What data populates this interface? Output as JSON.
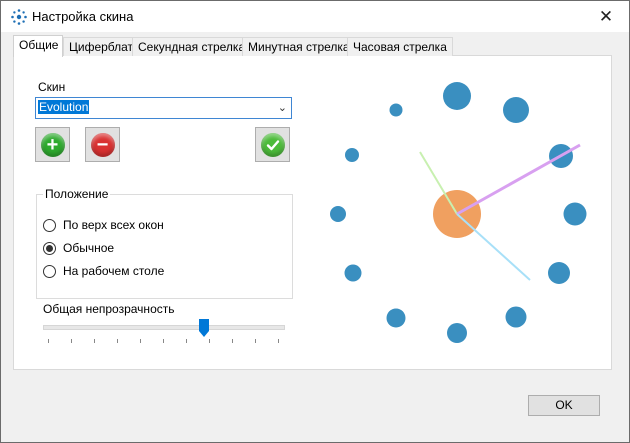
{
  "window": {
    "title": "Настройка скина",
    "close_glyph": "✕"
  },
  "tabs": [
    {
      "label": "Общие",
      "active": true
    },
    {
      "label": "Циферблат",
      "active": false
    },
    {
      "label": "Секундная стрелка",
      "active": false
    },
    {
      "label": "Минутная стрелка",
      "active": false
    },
    {
      "label": "Часовая стрелка",
      "active": false
    }
  ],
  "skin": {
    "label": "Скин",
    "selected": "Evolution",
    "add_icon": "plus-icon",
    "remove_icon": "minus-icon",
    "apply_icon": "checkmark-icon"
  },
  "position": {
    "legend": "Положение",
    "options": [
      {
        "label": "По верх всех окон",
        "checked": false
      },
      {
        "label": "Обычное",
        "checked": true
      },
      {
        "label": "На рабочем столе",
        "checked": false
      }
    ]
  },
  "opacity": {
    "label": "Общая непрозрачность",
    "value_fraction": 0.67
  },
  "clock_preview": {
    "dot_color": "#3a8fc0",
    "center_color": "#f0a060",
    "second_hand_color": "#a8e8f0",
    "minute_hand_color": "#d8a0f0",
    "hour_hand_color": "#c8f0b0"
  },
  "buttons": {
    "ok": "OK"
  },
  "colors": {
    "accent": "#0078d7",
    "add_green": "#2eaa2e",
    "remove_red": "#d93030",
    "apply_green": "#4cbb3a"
  }
}
